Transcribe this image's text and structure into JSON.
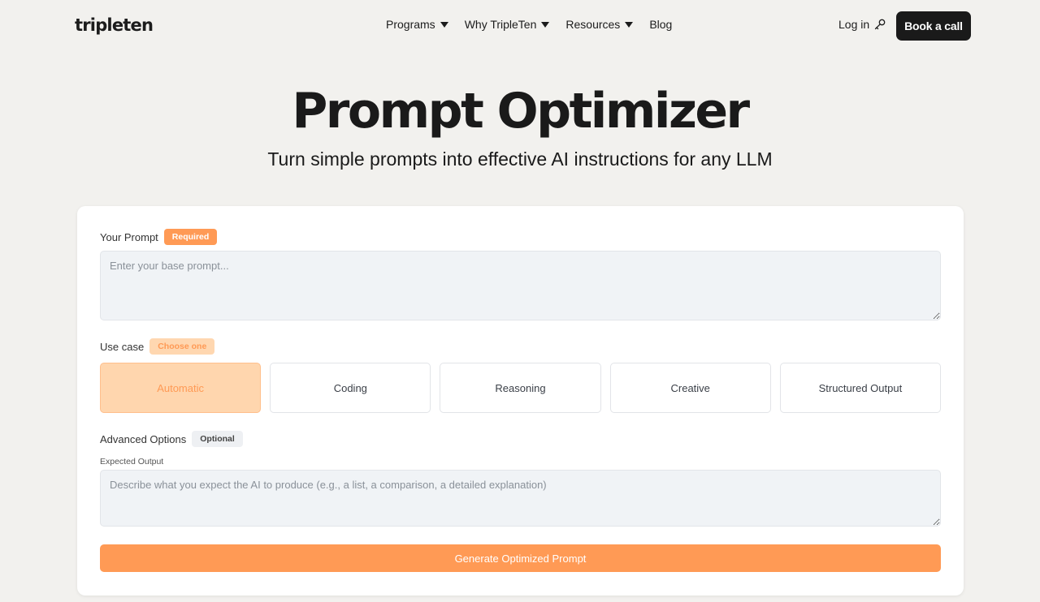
{
  "header": {
    "logo": "tripleten",
    "nav": [
      {
        "label": "Programs",
        "has_dropdown": true
      },
      {
        "label": "Why TripleTen",
        "has_dropdown": true
      },
      {
        "label": "Resources",
        "has_dropdown": true
      },
      {
        "label": "Blog",
        "has_dropdown": false
      }
    ],
    "login_label": "Log in",
    "login_icon": "key-icon",
    "cta_label": "Book a call"
  },
  "hero": {
    "title": "Prompt Optimizer",
    "subtitle": "Turn simple prompts into effective AI instructions for any LLM"
  },
  "form": {
    "prompt": {
      "label": "Your Prompt",
      "badge": "Required",
      "placeholder": "Enter your base prompt...",
      "value": ""
    },
    "use_case": {
      "label": "Use case",
      "badge": "Choose one",
      "options": [
        "Automatic",
        "Coding",
        "Reasoning",
        "Creative",
        "Structured Output"
      ],
      "selected": "Automatic"
    },
    "advanced": {
      "label": "Advanced Options",
      "badge": "Optional",
      "expected_output_label": "Expected Output",
      "expected_output_placeholder": "Describe what you expect the AI to produce (e.g., a list, a comparison, a detailed explanation)",
      "expected_output_value": ""
    },
    "submit_label": "Generate Optimized Prompt"
  },
  "colors": {
    "page_bg": "#f2f1ee",
    "accent": "#ff9a55",
    "accent_light": "#ffd6ae",
    "dark_button": "#1a1a1a"
  }
}
